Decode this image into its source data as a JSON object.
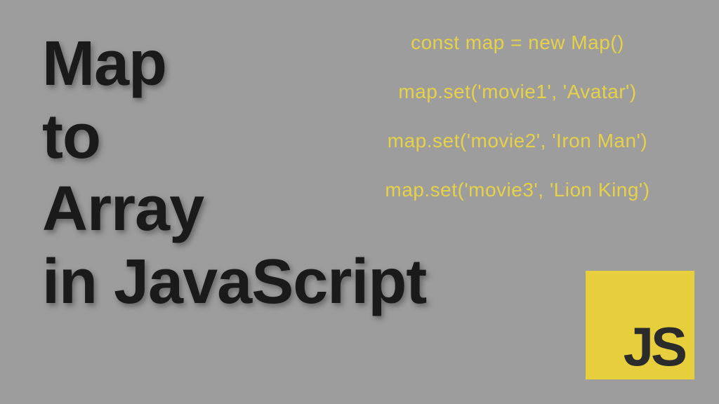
{
  "title": {
    "line1": "Map",
    "line2": "to",
    "line3": "Array",
    "line4": "in JavaScript"
  },
  "code": {
    "line1": "const map = new Map()",
    "line2": "map.set('movie1', 'Avatar')",
    "line3": "map.set('movie2', 'Iron Man')",
    "line4": "map.set('movie3', 'Lion King')"
  },
  "logo": {
    "text": "JS"
  }
}
